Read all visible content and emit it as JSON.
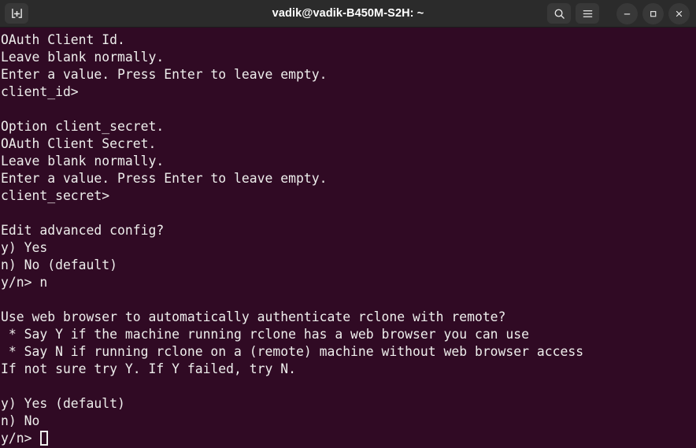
{
  "window": {
    "title": "vadik@vadik-B450M-S2H: ~",
    "titlebar_color": "#2b2b2b",
    "terminal_bg": "#300a24",
    "terminal_fg": "#eeeeec"
  },
  "titlebar": {
    "new_tab_label": "+",
    "search_label": "⌕",
    "menu_label": "≡",
    "minimize_label": "—",
    "maximize_label": "□",
    "close_label": "✕"
  },
  "terminal": {
    "lines": [
      "OAuth Client Id.",
      "Leave blank normally.",
      "Enter a value. Press Enter to leave empty.",
      "client_id>",
      "",
      "Option client_secret.",
      "OAuth Client Secret.",
      "Leave blank normally.",
      "Enter a value. Press Enter to leave empty.",
      "client_secret>",
      "",
      "Edit advanced config?",
      "y) Yes",
      "n) No (default)",
      "y/n> n",
      "",
      "Use web browser to automatically authenticate rclone with remote?",
      " * Say Y if the machine running rclone has a web browser you can use",
      " * Say N if running rclone on a (remote) machine without web browser access",
      "If not sure try Y. If Y failed, try N.",
      "",
      "y) Yes (default)",
      "n) No"
    ],
    "prompt": "y/n> ",
    "cursor": "block-outline"
  }
}
